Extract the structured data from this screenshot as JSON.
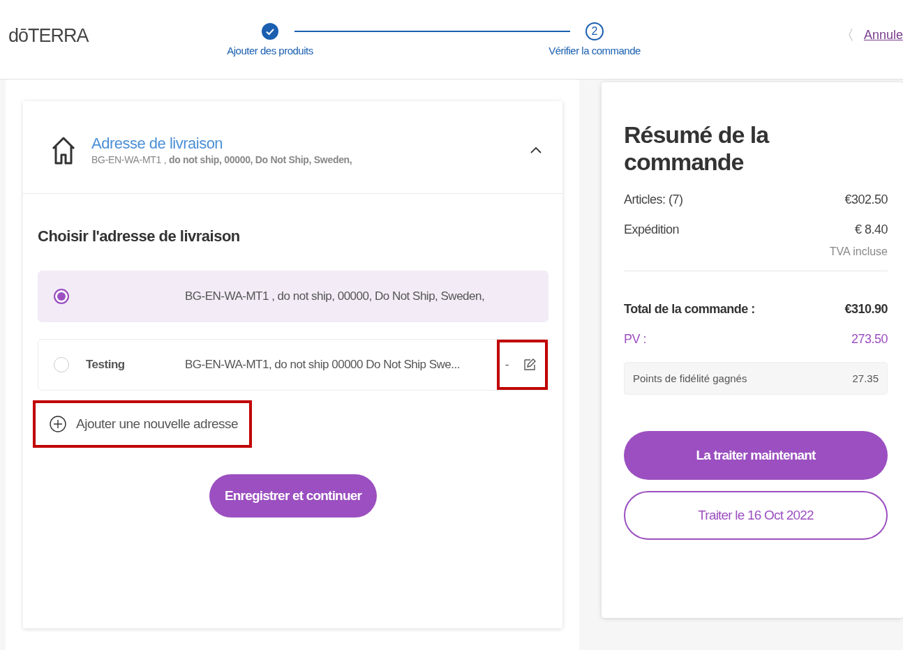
{
  "header": {
    "logo": "dōTERRA",
    "steps": [
      {
        "label": "Ajouter des produits",
        "done": true
      },
      {
        "label": "Vérifier la commande",
        "number": "2",
        "done": false
      }
    ],
    "back_icon": "〈",
    "cancel_link": "Annule"
  },
  "shipping": {
    "title": "Adresse de livraison",
    "summary": "BG-EN-WA-MT1 , **do not ship, 00000, Do Not Ship, Sweden,**",
    "expanded": true,
    "choose_title": "Choisir l'adresse de livraison",
    "addresses": [
      {
        "address": "BG-EN-WA-MT1 , do not ship, 00000, Do Not Ship, Sweden,",
        "selected": true,
        "editable": false
      },
      {
        "name": "Testing",
        "address": "BG-EN-WA-MT1, do not ship 00000 Do Not Ship Swe...",
        "selected": false,
        "editable": true,
        "separator": "-",
        "highlighted": true
      }
    ],
    "add_address": {
      "label": "Ajouter une nouvelle adresse",
      "highlighted": true
    },
    "save_button": "Enregistrer et continuer"
  },
  "summary": {
    "title": "Résumé de la commande",
    "lines": [
      {
        "label": "Articles: (7)",
        "value": "€302.50"
      },
      {
        "label": "Expédition",
        "value": "€ 8.40"
      }
    ],
    "tax_note": "TVA incluse",
    "total": {
      "label": "Total de la commande :",
      "value": "€310.90"
    },
    "pv": {
      "label": "PV :",
      "value": "273.50"
    },
    "points": {
      "label": "Points de fidélité gagnés",
      "value": "27.35"
    },
    "buttons": [
      {
        "label": "La traiter maintenant",
        "kind": "primary"
      },
      {
        "label": "Traiter le 16 Oct 2022",
        "kind": "outline"
      }
    ]
  }
}
